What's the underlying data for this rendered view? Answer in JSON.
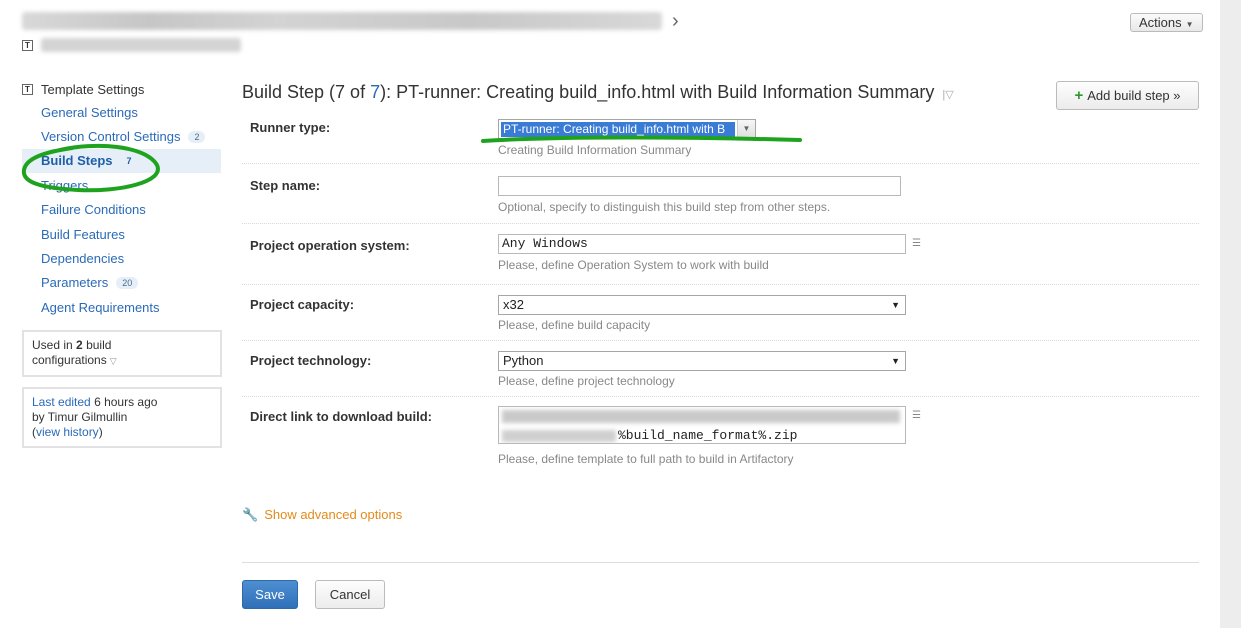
{
  "header": {
    "actions_label": "Actions",
    "template_icon": "T"
  },
  "sidebar": {
    "title": "Template Settings",
    "items": [
      {
        "label": "General Settings"
      },
      {
        "label": "Version Control Settings",
        "count": "2"
      },
      {
        "label": "Build Steps",
        "count": "7",
        "active": true
      },
      {
        "label": "Triggers"
      },
      {
        "label": "Failure Conditions"
      },
      {
        "label": "Build Features"
      },
      {
        "label": "Dependencies"
      },
      {
        "label": "Parameters",
        "count": "20"
      },
      {
        "label": "Agent Requirements"
      }
    ],
    "used_in": {
      "prefix": "Used in",
      "count": "2",
      "suffix": "build",
      "line2": "configurations"
    },
    "last_edited": {
      "link": "Last edited",
      "time": "6 hours ago",
      "by": "by Timur Gilmullin",
      "open_paren": "(",
      "history_link": "view history",
      "close_paren": ")"
    }
  },
  "main": {
    "title_prefix": "Build Step (7 of",
    "title_total": "7",
    "title_suffix": "): PT-runner: Creating build_info.html with Build Information Summary",
    "add_step_label": "Add build step »",
    "fields": {
      "runner_type": {
        "label": "Runner type:",
        "value": "PT-runner: Creating build_info.html with B",
        "hint": "Creating Build Information Summary"
      },
      "step_name": {
        "label": "Step name:",
        "value": "",
        "hint": "Optional, specify to distinguish this build step from other steps."
      },
      "os": {
        "label": "Project operation system:",
        "value": "Any Windows",
        "hint": "Please, define Operation System to work with build"
      },
      "capacity": {
        "label": "Project capacity:",
        "value": "x32",
        "hint": "Please, define build capacity"
      },
      "technology": {
        "label": "Project technology:",
        "value": "Python",
        "hint": "Please, define project technology"
      },
      "download_link": {
        "label": "Direct link to download build:",
        "value_tail": "%build_name_format%.zip",
        "hint": "Please, define template to full path to build in Artifactory"
      }
    },
    "advanced_label": "Show advanced options",
    "save_label": "Save",
    "cancel_label": "Cancel"
  },
  "colors": {
    "link": "#2a6ab8",
    "annotation": "#1fa31f",
    "advanced": "#e48a1a",
    "save": "#3a7fc6"
  }
}
